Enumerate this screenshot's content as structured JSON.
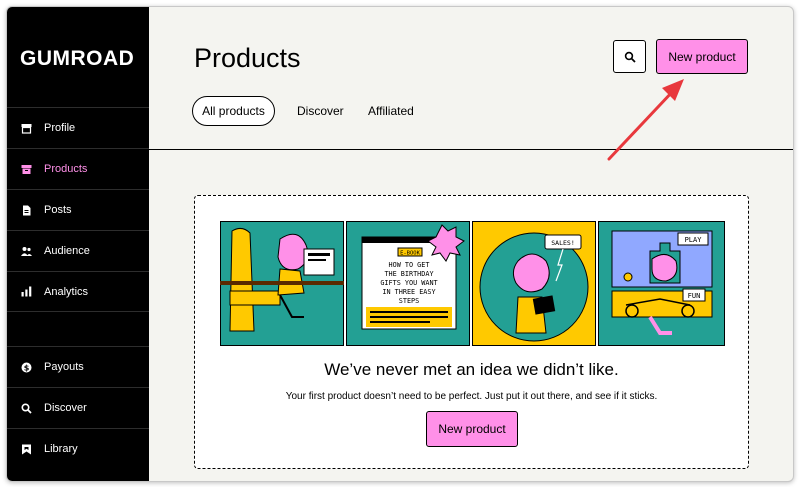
{
  "brand": {
    "logo": "GUMROAD"
  },
  "sidebar": {
    "items": [
      {
        "label": "Profile",
        "icon": "shop-icon"
      },
      {
        "label": "Products",
        "icon": "archive-icon",
        "active": true
      },
      {
        "label": "Posts",
        "icon": "document-icon"
      },
      {
        "label": "Audience",
        "icon": "people-icon"
      },
      {
        "label": "Analytics",
        "icon": "bar-chart-icon"
      },
      {
        "label": "Payouts",
        "icon": "dollar-circle-icon"
      },
      {
        "label": "Discover",
        "icon": "search-icon"
      },
      {
        "label": "Library",
        "icon": "bookmark-icon"
      }
    ]
  },
  "header": {
    "title": "Products",
    "new_product_label": "New product",
    "search_icon": "search-icon"
  },
  "tabs": [
    {
      "label": "All products",
      "active": true
    },
    {
      "label": "Discover"
    },
    {
      "label": "Affiliated"
    }
  ],
  "empty_state": {
    "headline": "We’ve never met an idea we didn’t like.",
    "subtext": "Your first product doesn’t need to be perfect. Just put it out there, and see if it sticks.",
    "cta_label": "New product",
    "illustration": {
      "ebook_tag": "E-BOOK",
      "ebook_text": [
        "HOW TO GET",
        "THE BIRTHDAY",
        "GIFTS YOU WANT",
        "IN THREE EASY",
        "STEPS"
      ],
      "sales_bubble": "SALES!",
      "play_sign": "PLAY",
      "fun_sign": "FUN"
    }
  },
  "colors": {
    "accent": "#ff90e8",
    "sidebar_bg": "#000000",
    "page_bg": "#f4f4f0",
    "panel_teal": "#23a094",
    "panel_yellow": "#ffc900",
    "annotation_arrow": "#e8383d"
  }
}
